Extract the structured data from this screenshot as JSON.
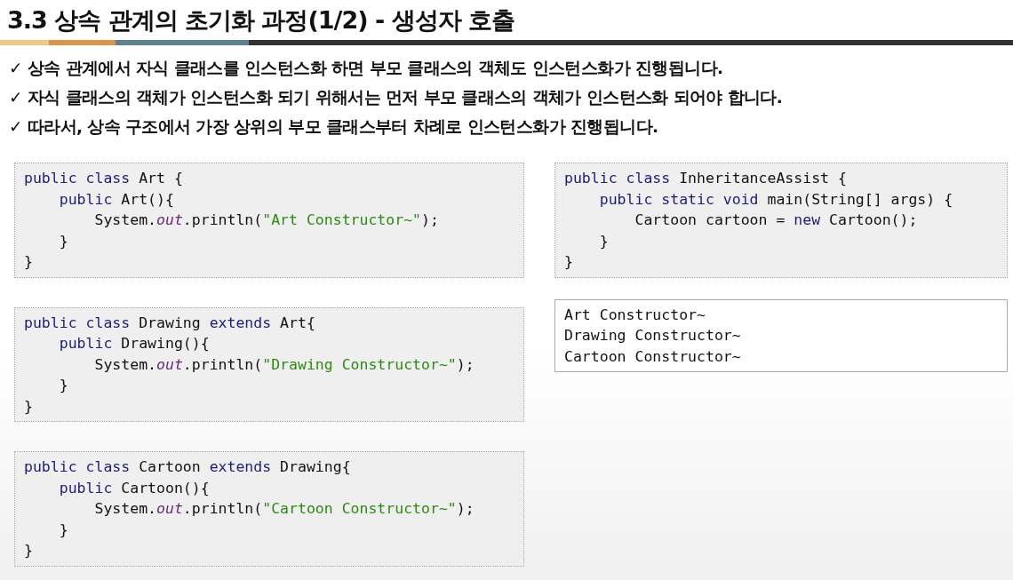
{
  "title": "3.3 상속 관계의 초기화 과정(1/2) - 생성자 호출",
  "bullets": [
    {
      "mark": "✓",
      "text": "상속 관계에서 자식 클래스를 인스턴스화 하면 부모 클래스의 객체도 인스턴스화가 진행됩니다."
    },
    {
      "mark": "✓",
      "text": "자식 클래스의 객체가 인스턴스화 되기 위해서는 먼저 부모 클래스의 객체가 인스턴스화 되어야 합니다."
    },
    {
      "mark": "✓",
      "text": "따라서, 상속 구조에서 가장 상위의 부모 클래스부터 차례로 인스턴스화가 진행됩니다."
    }
  ],
  "left_code": [
    {
      "lines": [
        [
          {
            "kind": "keyword",
            "text": "public class "
          },
          {
            "kind": "plain",
            "text": "Art {"
          }
        ],
        [
          {
            "kind": "keyword",
            "text": "    public "
          },
          {
            "kind": "plain",
            "text": "Art(){"
          }
        ],
        [
          {
            "kind": "plain",
            "text": "        System."
          },
          {
            "kind": "field",
            "text": "out"
          },
          {
            "kind": "plain",
            "text": ".println("
          },
          {
            "kind": "string",
            "text": "\"Art Constructor~\""
          },
          {
            "kind": "plain",
            "text": ");"
          }
        ],
        [
          {
            "kind": "plain",
            "text": "    }"
          }
        ],
        [
          {
            "kind": "plain",
            "text": "}"
          }
        ]
      ]
    },
    {
      "lines": [
        [
          {
            "kind": "keyword",
            "text": "public class "
          },
          {
            "kind": "plain",
            "text": "Drawing "
          },
          {
            "kind": "keyword",
            "text": "extends "
          },
          {
            "kind": "plain",
            "text": "Art{"
          }
        ],
        [
          {
            "kind": "keyword",
            "text": "    public "
          },
          {
            "kind": "plain",
            "text": "Drawing(){"
          }
        ],
        [
          {
            "kind": "plain",
            "text": "        System."
          },
          {
            "kind": "field",
            "text": "out"
          },
          {
            "kind": "plain",
            "text": ".println("
          },
          {
            "kind": "string",
            "text": "\"Drawing Constructor~\""
          },
          {
            "kind": "plain",
            "text": ");"
          }
        ],
        [
          {
            "kind": "plain",
            "text": "    }"
          }
        ],
        [
          {
            "kind": "plain",
            "text": "}"
          }
        ]
      ]
    },
    {
      "lines": [
        [
          {
            "kind": "keyword",
            "text": "public class "
          },
          {
            "kind": "plain",
            "text": "Cartoon "
          },
          {
            "kind": "keyword",
            "text": "extends "
          },
          {
            "kind": "plain",
            "text": "Drawing{"
          }
        ],
        [
          {
            "kind": "keyword",
            "text": "    public "
          },
          {
            "kind": "plain",
            "text": "Cartoon(){"
          }
        ],
        [
          {
            "kind": "plain",
            "text": "        System."
          },
          {
            "kind": "field",
            "text": "out"
          },
          {
            "kind": "plain",
            "text": ".println("
          },
          {
            "kind": "string",
            "text": "\"Cartoon Constructor~\""
          },
          {
            "kind": "plain",
            "text": ");"
          }
        ],
        [
          {
            "kind": "plain",
            "text": "    }"
          }
        ],
        [
          {
            "kind": "plain",
            "text": "}"
          }
        ]
      ]
    }
  ],
  "main_code": {
    "lines": [
      [
        {
          "kind": "keyword",
          "text": "public class "
        },
        {
          "kind": "plain",
          "text": "InheritanceAssist {"
        }
      ],
      [
        {
          "kind": "keyword",
          "text": "    public static void "
        },
        {
          "kind": "plain",
          "text": "main(String[] args) {"
        }
      ],
      [
        {
          "kind": "plain",
          "text": "        Cartoon cartoon = "
        },
        {
          "kind": "keyword",
          "text": "new "
        },
        {
          "kind": "plain",
          "text": "Cartoon();"
        }
      ],
      [
        {
          "kind": "plain",
          "text": "    }"
        }
      ],
      [
        {
          "kind": "plain",
          "text": "}"
        }
      ]
    ]
  },
  "console_output": [
    "Art Constructor~",
    "Drawing Constructor~",
    "Cartoon Constructor~"
  ]
}
